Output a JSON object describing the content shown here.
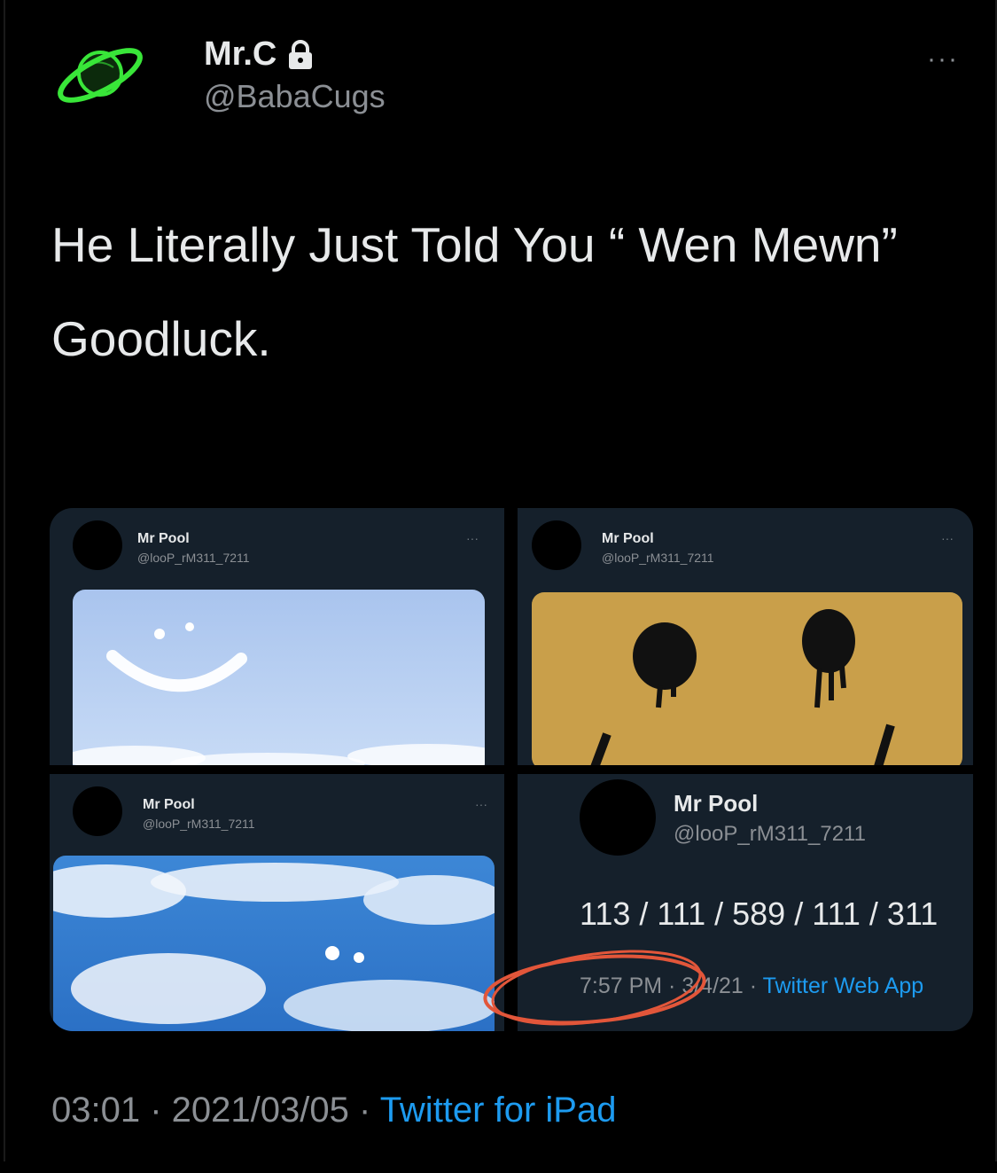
{
  "tweet": {
    "author_name": "Mr.C",
    "author_handle": "@BabaCugs",
    "text_line1": "He Literally Just Told You “ Wen Mewn”",
    "text_line2": "Goodluck.",
    "time": "03:01",
    "date": "2021/03/05",
    "source": "Twitter for iPad",
    "separator": " · "
  },
  "media": {
    "tweets": [
      {
        "name": "Mr Pool",
        "handle": "@looP_rM311_7211"
      },
      {
        "name": "Mr Pool",
        "handle": "@looP_rM311_7211"
      },
      {
        "name": "Mr Pool",
        "handle": "@looP_rM311_7211"
      },
      {
        "name": "Mr Pool",
        "handle": "@looP_rM311_7211",
        "text": "113 / 111 / 589 / 111 / 311",
        "time": "7:57 PM",
        "date": "3/4/21",
        "source": "Twitter Web App"
      }
    ],
    "more_label": "···"
  },
  "icons": {
    "avatar": "planet-icon",
    "lock": "lock-icon",
    "more": "more-icon",
    "annotation": "red-circle-annotation"
  },
  "colors": {
    "background": "#000000",
    "card": "#15202b",
    "accent": "#1d9bf0",
    "planet": "#39e639",
    "annotation": "#e2563a"
  }
}
